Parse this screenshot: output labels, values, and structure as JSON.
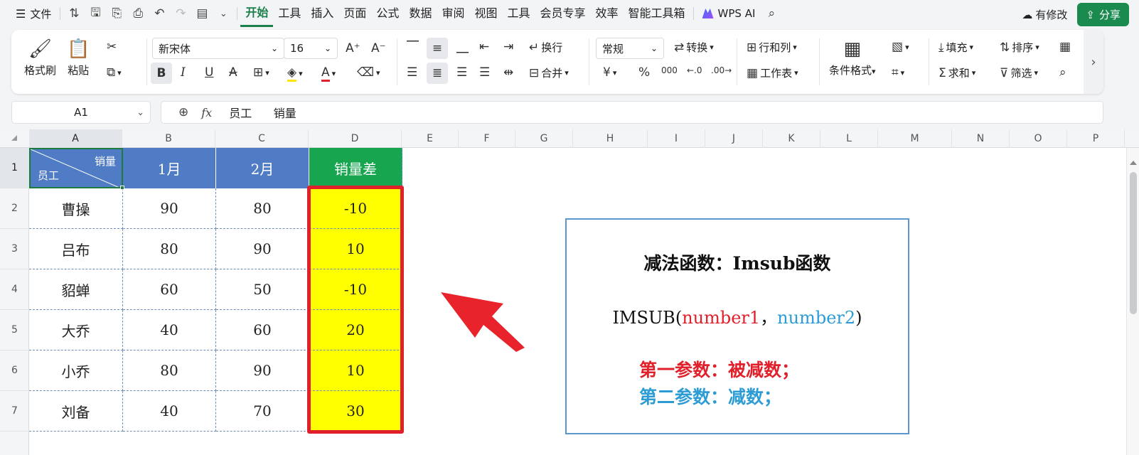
{
  "menubar": {
    "file": "文件",
    "tabs": [
      "开始",
      "工具",
      "插入",
      "页面",
      "公式",
      "数据",
      "审阅",
      "视图",
      "工具",
      "会员专享",
      "效率",
      "智能工具箱"
    ],
    "wps_ai": "WPS AI",
    "revise": "有修改",
    "share": "分享"
  },
  "ribbon": {
    "format_painter": "格式刷",
    "paste": "粘贴",
    "font_name": "新宋体",
    "font_size": "16",
    "wrap": "换行",
    "merge": "合并",
    "number_format": "常规",
    "convert": "转换",
    "row_col": "行和列",
    "worksheet": "工作表",
    "cond_format": "条件格式",
    "fill": "填充",
    "sort": "排序",
    "sum": "求和",
    "filter": "筛选",
    "bold": "B",
    "italic": "I",
    "underline": "U",
    "percent": "%",
    "currency": "¥",
    "thousands": "000"
  },
  "formula_bar": {
    "cell_ref": "A1",
    "fx": "fx",
    "content": "员工      销量"
  },
  "sheet": {
    "columns": [
      "A",
      "B",
      "C",
      "D",
      "E",
      "F",
      "G",
      "H",
      "I",
      "J",
      "K",
      "L",
      "M",
      "N",
      "O",
      "P"
    ],
    "rows": [
      "1",
      "2",
      "3",
      "4",
      "5",
      "6",
      "7"
    ],
    "header_diag_top": "销量",
    "header_diag_bottom": "员工",
    "headers": [
      "1月",
      "2月",
      "销量差"
    ],
    "data": [
      [
        "曹操",
        "90",
        "80",
        "-10"
      ],
      [
        "吕布",
        "80",
        "90",
        "10"
      ],
      [
        "貂蝉",
        "60",
        "50",
        "-10"
      ],
      [
        "大乔",
        "40",
        "60",
        "20"
      ],
      [
        "小乔",
        "80",
        "90",
        "10"
      ],
      [
        "刘备",
        "40",
        "70",
        "30"
      ]
    ]
  },
  "note": {
    "title": "减法函数：Imsub函数",
    "formula_prefix": "IMSUB(",
    "formula_arg1": "number1",
    "formula_sep": "，",
    "formula_arg2": "number2",
    "formula_suffix": ")",
    "param1": "第一参数：被减数；",
    "param2": "第二参数：减数；"
  },
  "colors": {
    "accent_green": "#1a7f48",
    "header_blue": "#4f7cc4",
    "header_green": "#18a550",
    "highlight_yellow": "#ffff00",
    "frame_red": "#e0202a",
    "param_blue": "#2d9cd5"
  }
}
